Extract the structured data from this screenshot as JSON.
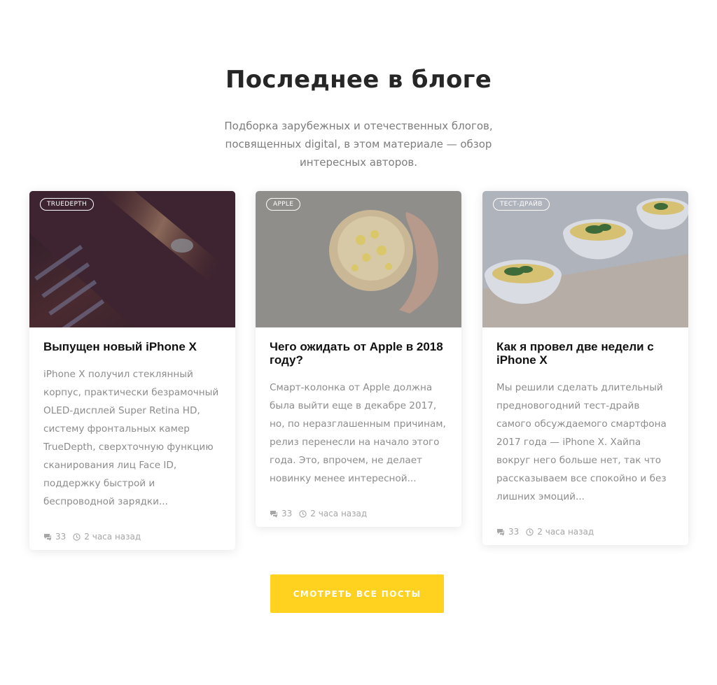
{
  "section": {
    "title": "Последнее в блоге",
    "subtitle": "Подборка зарубежных и отечественных блогов, посвященных digital, в этом материале — обзор интересных авторов."
  },
  "posts": [
    {
      "tag": "TRUEDEPTH",
      "title": "Выпущен новый iPhone X",
      "excerpt": "iPhone X получил стеклянный корпус, практически безрамочный OLED-дисплей Super Retina HD, систему фронтальных камер TrueDepth, сверхточную функцию сканирования лиц Face ID, поддержку быстрой и беспроводной зарядки...",
      "comments": "33",
      "time": "2 часа назад"
    },
    {
      "tag": "APPLE",
      "title": "Чего ожидать от Apple в 2018 году?",
      "excerpt": "Смарт-колонка от Apple должна была выйти еще в декабре 2017, но, по неразглашенным причинам, релиз перенесли на начало этого года. Это, впрочем, не делает новинку менее интересной...",
      "comments": "33",
      "time": "2 часа назад"
    },
    {
      "tag": "ТЕСТ-ДРАЙВ",
      "title": "Как я провел две недели с iPhone X",
      "excerpt": "Мы решили сделать длительный предновогодний тест-драйв самого обсуждаемого смартфона 2017 года — iPhone X. Хайпа вокруг него больше нет, так что рассказываем все спокойно и без лишних эмоций...",
      "comments": "33",
      "time": "2 часа назад"
    }
  ],
  "cta": {
    "label": "Смотреть все посты"
  },
  "icons": {
    "comments": "comments-icon",
    "time": "clock-icon"
  },
  "colors": {
    "accent": "#ffd21f",
    "title": "#262626",
    "text": "#8c8c8c"
  }
}
